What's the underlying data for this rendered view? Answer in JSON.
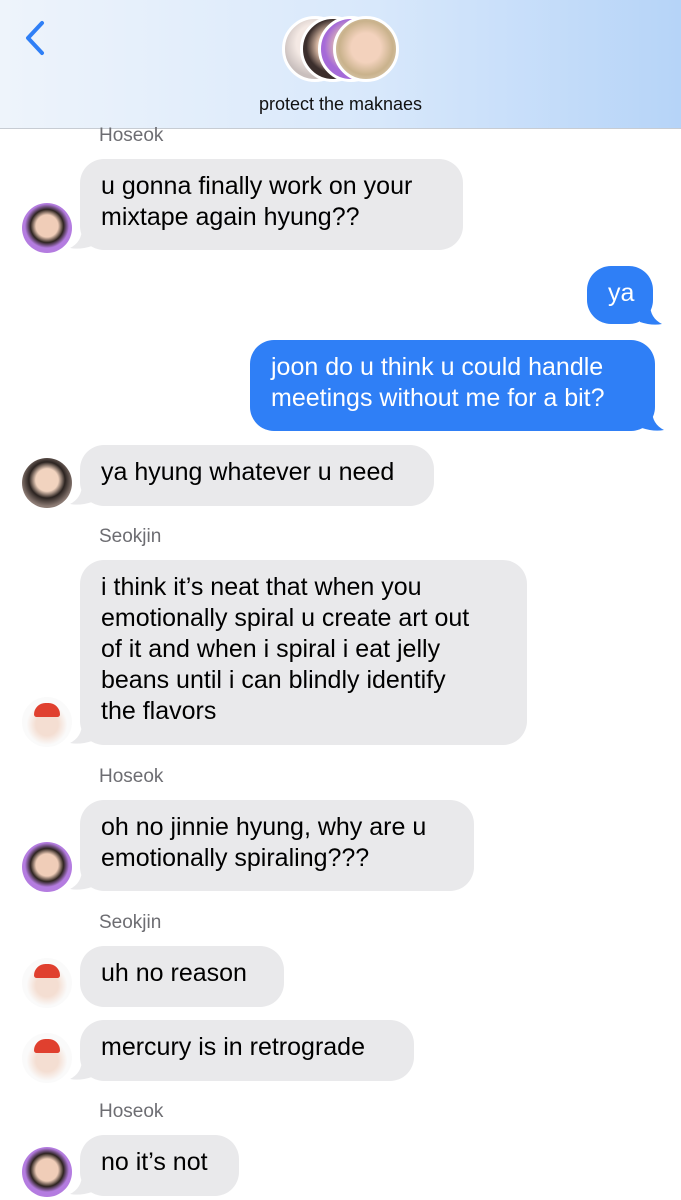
{
  "header": {
    "title": "protect the maknaes"
  },
  "icons": {
    "back": "chevron-left-icon",
    "avatar": "user-avatar"
  },
  "colors": {
    "outgoing": "#2f7ff6",
    "incoming": "#e9e9eb",
    "accent": "#2f7ff6"
  },
  "senders": [
    "Hoseok",
    "Seokjin",
    "Hoseok",
    "Seokjin",
    "Hoseok"
  ],
  "messages": [
    {
      "lines": [
        "u gonna finally work on your",
        "mixtape again hyung??"
      ]
    },
    {
      "lines": [
        "ya"
      ]
    },
    {
      "lines": [
        "joon do u think u could handle",
        "meetings without me for a bit?"
      ]
    },
    {
      "lines": [
        "ya hyung whatever u need"
      ]
    },
    {
      "lines": [
        "i think it’s neat that when you",
        "emotionally spiral u create art out",
        "of it and when i spiral i eat jelly",
        "beans until i can blindly identify",
        "the flavors"
      ]
    },
    {
      "lines": [
        "oh no jinnie hyung, why are u",
        "emotionally spiraling???"
      ]
    },
    {
      "lines": [
        "uh no reason"
      ]
    },
    {
      "lines": [
        "mercury is in retrograde"
      ]
    },
    {
      "lines": [
        "no it’s not"
      ]
    }
  ]
}
